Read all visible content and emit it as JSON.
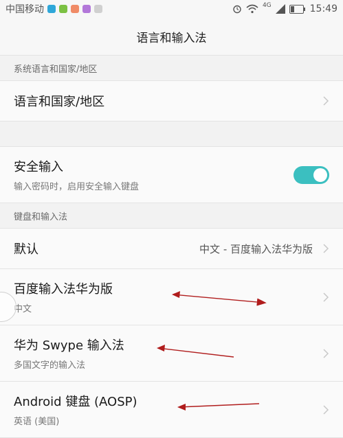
{
  "statusbar": {
    "carrier": "中国移动",
    "network": "4G",
    "time": "15:49"
  },
  "header": {
    "title": "语言和输入法"
  },
  "sections": {
    "system_language": {
      "header": "系统语言和国家/地区",
      "item": {
        "title": "语言和国家/地区"
      }
    },
    "secure_input": {
      "title": "安全输入",
      "subtitle": "输入密码时，启用安全输入键盘",
      "toggle_on": true,
      "accent": "#3bbfc0"
    },
    "keyboards": {
      "header": "键盘和输入法",
      "default": {
        "title": "默认",
        "value": "中文 - 百度输入法华为版"
      },
      "items": [
        {
          "title": "百度输入法华为版",
          "subtitle": "中文"
        },
        {
          "title": "华为 Swype 输入法",
          "subtitle": "多国文字的输入法"
        },
        {
          "title": "Android 键盘 (AOSP)",
          "subtitle": "英语 (美国)"
        }
      ]
    }
  },
  "annotations": {
    "arrow_color": "#b01c1c"
  }
}
